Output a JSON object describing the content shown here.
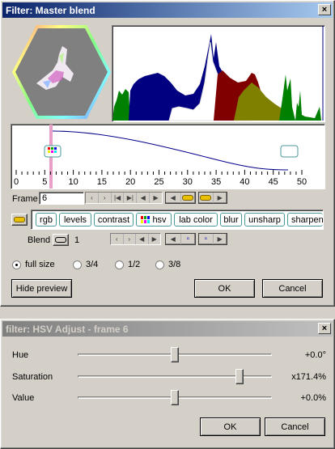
{
  "filter_window": {
    "title": "Filter: Master blend",
    "close_glyph": "×",
    "curve_axis_ticks": [
      "0",
      "5",
      "10",
      "15",
      "20",
      "25",
      "30",
      "35",
      "40",
      "45",
      "50"
    ],
    "frame_label": "Frame",
    "frame_value": "6",
    "chips": [
      {
        "label": "rgb"
      },
      {
        "label": "levels"
      },
      {
        "label": "contrast"
      },
      {
        "label": "hsv"
      },
      {
        "label": "lab color"
      },
      {
        "label": "blur"
      },
      {
        "label": "unsharp"
      },
      {
        "label": "sharpen"
      }
    ],
    "blend_label": "Blend",
    "blend_value": "1",
    "preview_sizes": [
      {
        "label": "full size",
        "selected": true
      },
      {
        "label": "3/4",
        "selected": false
      },
      {
        "label": "1/2",
        "selected": false
      },
      {
        "label": "3/8",
        "selected": false
      }
    ],
    "hide_preview_label": "Hide preview",
    "ok_label": "OK",
    "cancel_label": "Cancel",
    "nav_glyphs": [
      "‹",
      "›",
      "|◀",
      "▶|",
      "◀",
      "▶"
    ],
    "accent": "#0a246a",
    "curve_color": "#00008b",
    "marker_color": "#e8a0c8"
  },
  "hsv_window": {
    "title": "filter: HSV Adjust - frame 6",
    "close_glyph": "×",
    "sliders": [
      {
        "label": "Hue",
        "value": "+0.0°",
        "level": 0.5
      },
      {
        "label": "Saturation",
        "value": "x171.4%",
        "level": 0.85
      },
      {
        "label": "Value",
        "value": "+0.0%",
        "level": 0.5
      }
    ],
    "ok_label": "OK",
    "cancel_label": "Cancel"
  }
}
